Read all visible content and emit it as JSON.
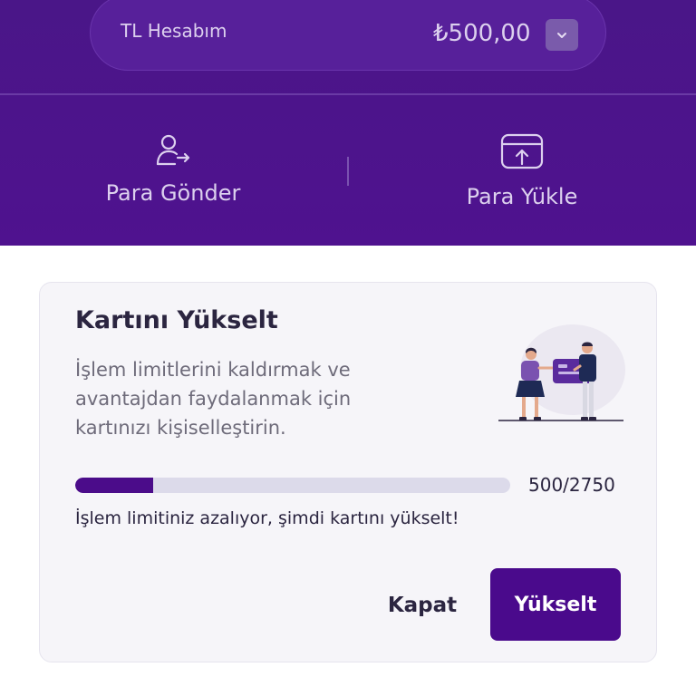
{
  "account": {
    "name": "TL Hesabım",
    "balance": "₺500,00",
    "dropdown_icon": "chevron-down-icon"
  },
  "actions": [
    {
      "label": "Para Gönder",
      "icon": "user-send-icon"
    },
    {
      "label": "Para Yükle",
      "icon": "card-upload-icon"
    }
  ],
  "upgrade_card": {
    "title": "Kartını Yükselt",
    "description": "İşlem limitlerini kaldırmak ve avantajdan faydalanmak için kartınızı kişiselleştirin.",
    "progress": {
      "current": 500,
      "total": 2750,
      "fraction": 0.18,
      "text": "500/2750"
    },
    "warning": "İşlem limitiniz azalıyor, şimdi kartını yükselt!",
    "close_label": "Kapat",
    "upgrade_label": "Yükselt",
    "illustration": "card-exchange-illustration"
  },
  "colors": {
    "header_bg": "#4f128f",
    "primary": "#4a0a8c",
    "progress_track": "#dcdaea",
    "card_bg": "#f6f5f9"
  }
}
